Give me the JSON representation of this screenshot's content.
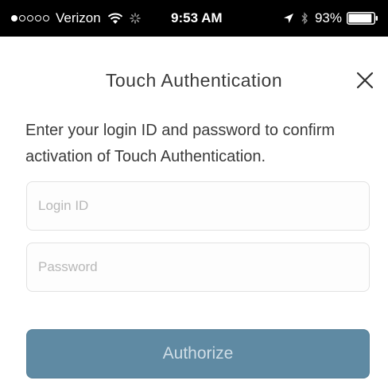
{
  "status_bar": {
    "carrier": "Verizon",
    "signal_dots_filled": 1,
    "signal_dots_total": 5,
    "time": "9:53 AM",
    "battery_percent": "93%",
    "battery_level": 0.93,
    "icons": [
      "wifi-icon",
      "activity-icon",
      "location-arrow-icon",
      "bluetooth-icon",
      "battery-icon"
    ]
  },
  "header": {
    "title": "Touch Authentication",
    "close_icon": "close-icon"
  },
  "instruction": "Enter your login ID and password to confirm activation of Touch Authentication.",
  "form": {
    "login_placeholder": "Login ID",
    "login_value": "",
    "password_placeholder": "Password",
    "password_value": ""
  },
  "authorize_label": "Authorize",
  "colors": {
    "button": "#5f8aa3",
    "button_text": "#cfdde6",
    "text": "#3a3a3a",
    "placeholder": "#b8b8b8"
  }
}
